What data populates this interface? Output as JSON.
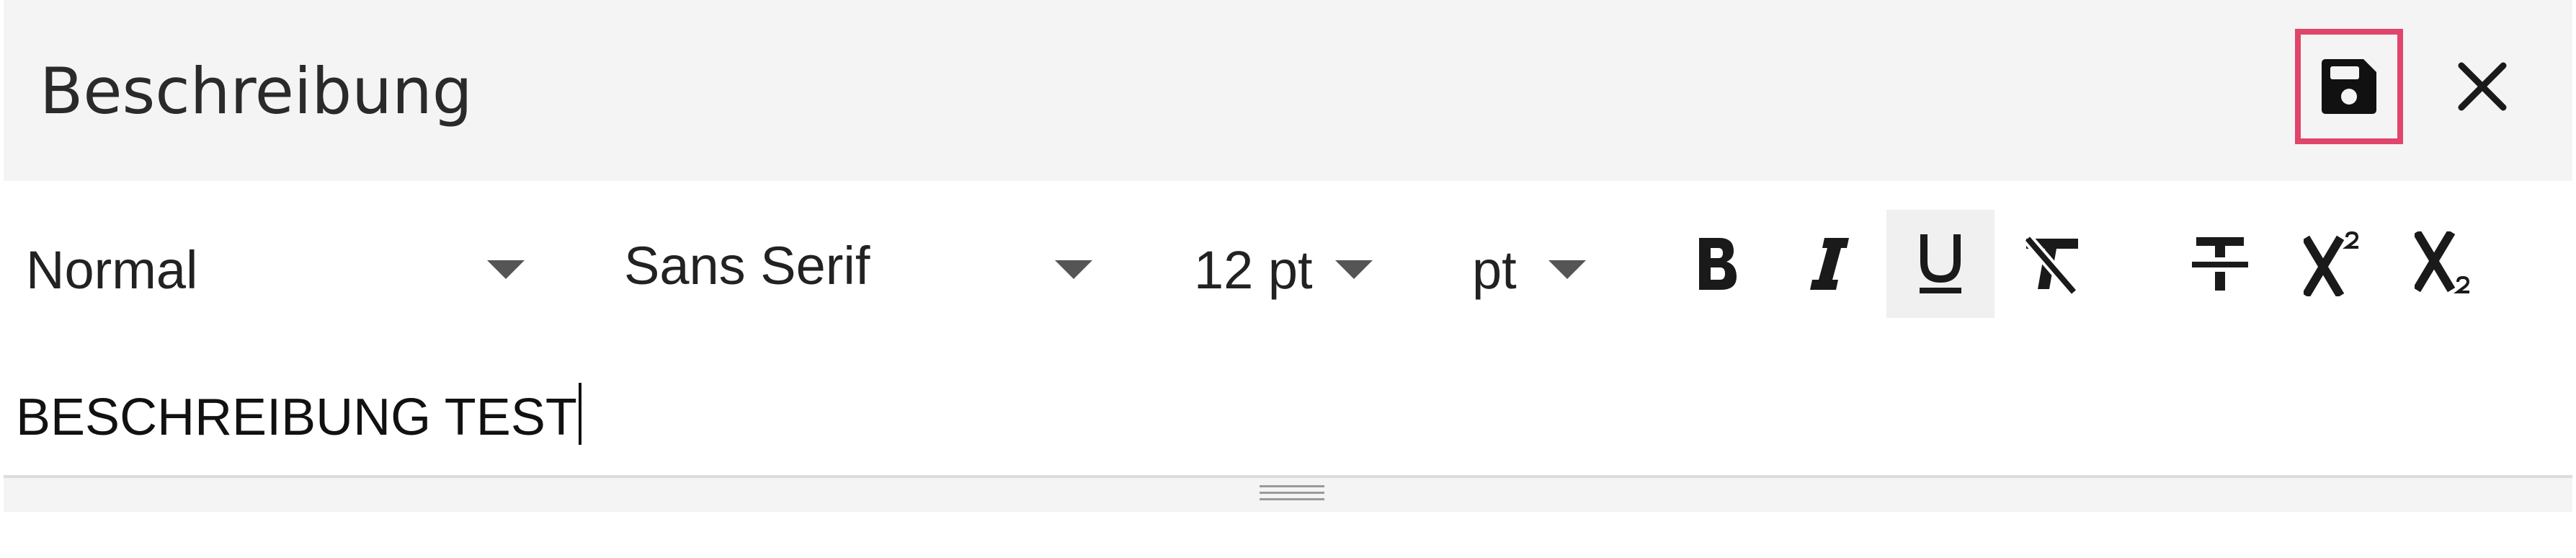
{
  "dialog": {
    "title": "Beschreibung",
    "save_icon": "floppy-disk-icon",
    "close_icon": "close-icon",
    "highlight_color": "#e0456c"
  },
  "toolbar": {
    "block_format": {
      "selected": "Normal"
    },
    "font_family": {
      "selected": "Sans Serif"
    },
    "font_size": {
      "selected": "12 pt"
    },
    "unit": {
      "selected": "pt"
    },
    "buttons": {
      "bold": "bold-icon",
      "italic": "italic-icon",
      "underline": "underline-icon",
      "clear_format": "clear-format-icon",
      "strikethrough": "strikethrough-icon",
      "superscript": "superscript-icon",
      "subscript": "subscript-icon"
    },
    "active_button": "underline"
  },
  "editor": {
    "content": "BESCHREIBUNG TEST"
  }
}
